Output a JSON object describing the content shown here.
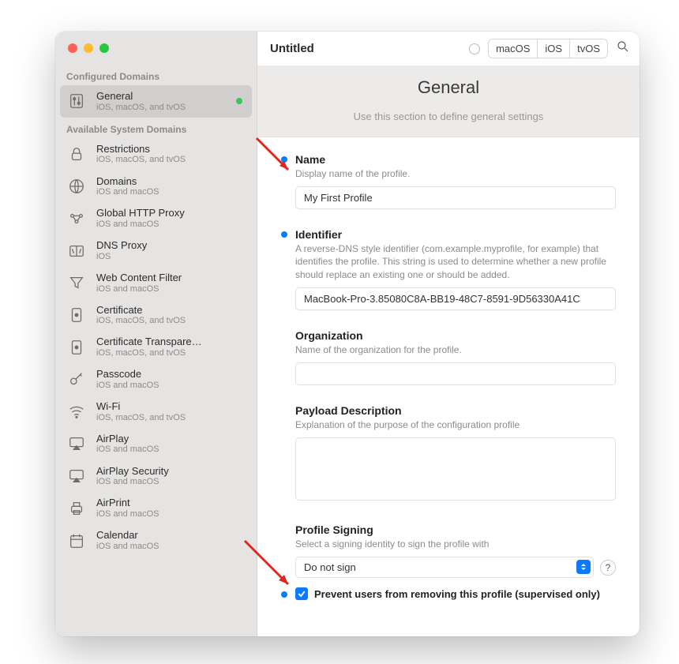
{
  "window": {
    "title": "Untitled",
    "platforms": [
      "macOS",
      "iOS",
      "tvOS"
    ]
  },
  "sidebar": {
    "configured_title": "Configured Domains",
    "available_title": "Available System Domains",
    "configured": [
      {
        "label": "General",
        "sub": "iOS, macOS, and tvOS",
        "icon": "sliders-icon",
        "status": "green"
      }
    ],
    "available": [
      {
        "label": "Restrictions",
        "sub": "iOS, macOS, and tvOS",
        "icon": "lock-icon"
      },
      {
        "label": "Domains",
        "sub": "iOS and macOS",
        "icon": "globe-icon"
      },
      {
        "label": "Global HTTP Proxy",
        "sub": "iOS and macOS",
        "icon": "proxy-icon"
      },
      {
        "label": "DNS Proxy",
        "sub": "iOS",
        "icon": "dns-icon"
      },
      {
        "label": "Web Content Filter",
        "sub": "iOS and macOS",
        "icon": "funnel-icon"
      },
      {
        "label": "Certificate",
        "sub": "iOS, macOS, and tvOS",
        "icon": "certificate-icon"
      },
      {
        "label": "Certificate Transpare…",
        "sub": "iOS, macOS, and tvOS",
        "icon": "certificate-icon"
      },
      {
        "label": "Passcode",
        "sub": "iOS and macOS",
        "icon": "key-icon"
      },
      {
        "label": "Wi-Fi",
        "sub": "iOS, macOS, and tvOS",
        "icon": "wifi-icon"
      },
      {
        "label": "AirPlay",
        "sub": "iOS and macOS",
        "icon": "airplay-icon"
      },
      {
        "label": "AirPlay Security",
        "sub": "iOS and macOS",
        "icon": "airplay-icon"
      },
      {
        "label": "AirPrint",
        "sub": "iOS and macOS",
        "icon": "printer-icon"
      },
      {
        "label": "Calendar",
        "sub": "iOS and macOS",
        "icon": "calendar-icon"
      }
    ]
  },
  "panel": {
    "title": "General",
    "hint": "Use this section to define general settings"
  },
  "fields": {
    "name": {
      "label": "Name",
      "desc": "Display name of the profile.",
      "value": "My First Profile"
    },
    "identifier": {
      "label": "Identifier",
      "desc": "A reverse-DNS style identifier (com.example.myprofile, for example) that identifies the profile. This string is used to determine whether a new profile should replace an existing one or should be added.",
      "value": "MacBook-Pro-3.85080C8A-BB19-48C7-8591-9D56330A41C"
    },
    "organization": {
      "label": "Organization",
      "desc": "Name of the organization for the profile.",
      "value": ""
    },
    "payload": {
      "label": "Payload Description",
      "desc": "Explanation of the purpose of the configuration profile",
      "value": ""
    },
    "signing": {
      "label": "Profile Signing",
      "desc": "Select a signing identity to sign the profile with",
      "value": "Do not sign",
      "help": "?"
    },
    "prevent_remove": {
      "label": "Prevent users from removing this profile (supervised only)",
      "checked": true
    }
  }
}
